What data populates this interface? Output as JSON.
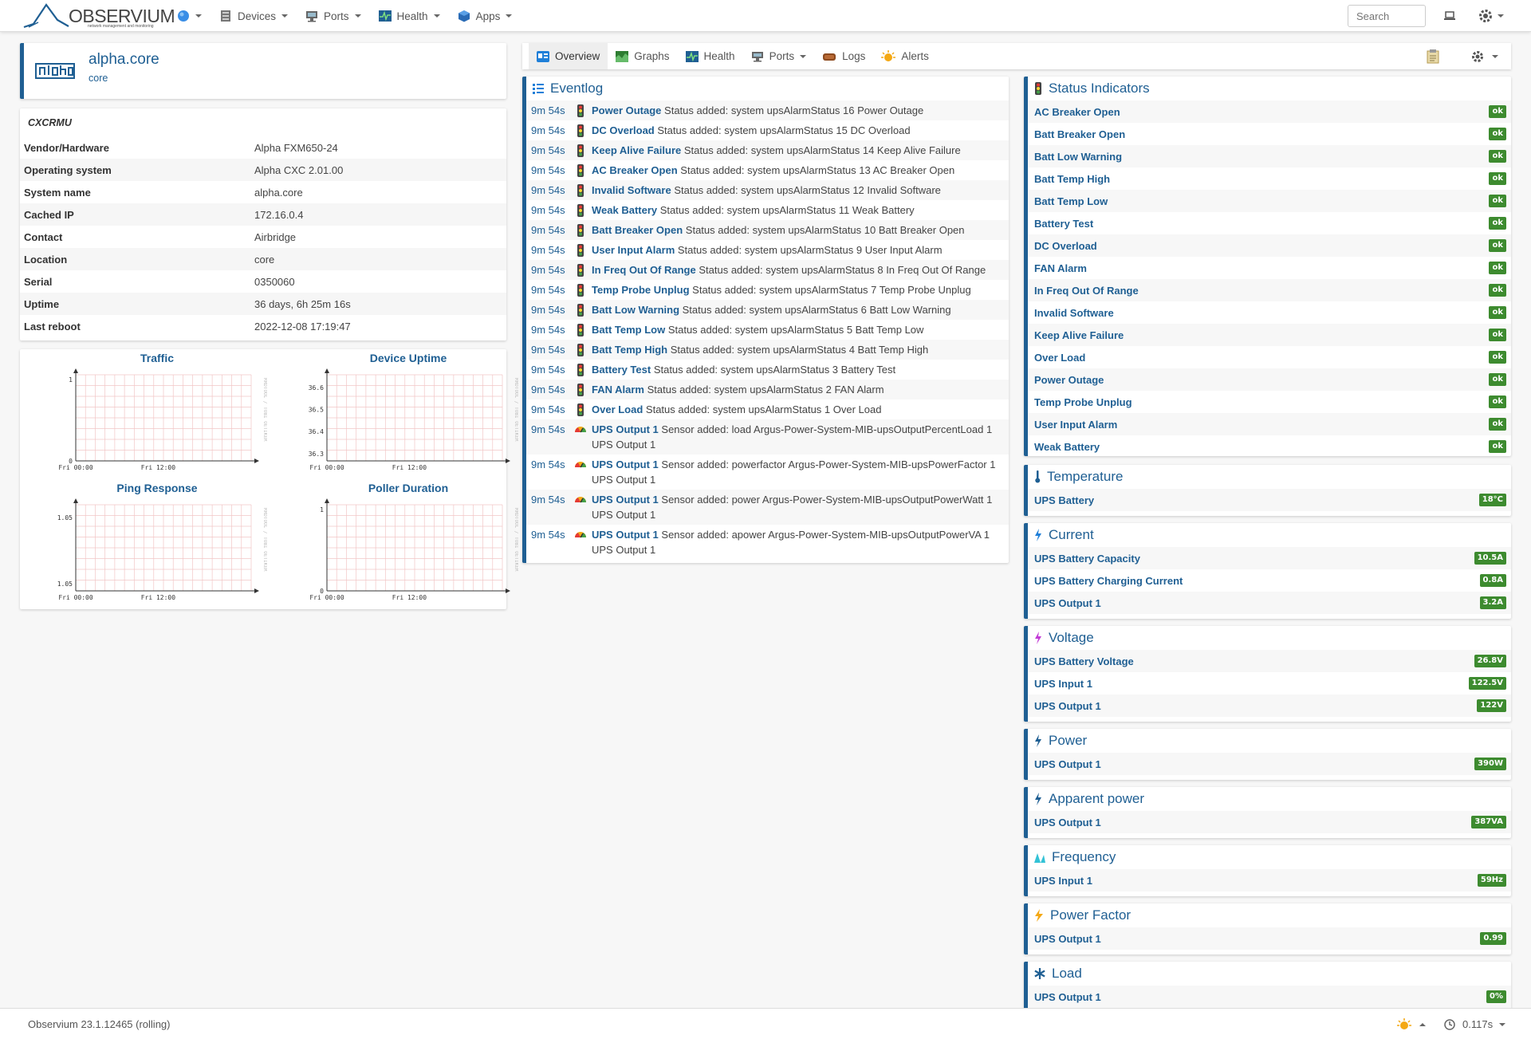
{
  "brand": {
    "name": "OBSERVIUM",
    "tagline": "network management and monitoring"
  },
  "nav": {
    "items": [
      {
        "label": "Devices"
      },
      {
        "label": "Ports"
      },
      {
        "label": "Health"
      },
      {
        "label": "Apps"
      }
    ],
    "search_placeholder": "Search"
  },
  "device": {
    "title": "alpha.core",
    "subtitle": "core",
    "logo_text": "alpha",
    "model_header": "CXCRMU",
    "info": [
      {
        "key": "Vendor/Hardware",
        "value": "Alpha FXM650-24"
      },
      {
        "key": "Operating system",
        "value": "Alpha CXC 2.01.00"
      },
      {
        "key": "System name",
        "value": "alpha.core"
      },
      {
        "key": "Cached IP",
        "value": "172.16.0.4"
      },
      {
        "key": "Contact",
        "value": "Airbridge"
      },
      {
        "key": "Location",
        "value": "core"
      },
      {
        "key": "Serial",
        "value": "0350060"
      },
      {
        "key": "Uptime",
        "value": "36 days, 6h 25m 16s"
      },
      {
        "key": "Last reboot",
        "value": "2022-12-08 17:19:47"
      }
    ]
  },
  "graphs": [
    {
      "title": "Traffic",
      "y_ticks": [
        "1",
        "0"
      ],
      "x_ticks": [
        "Fri 00:00",
        "Fri 12:00"
      ],
      "watermark": "RRDTOOL / TOBI OETIKER"
    },
    {
      "title": "Device Uptime",
      "y_ticks": [
        "36.6",
        "36.5",
        "36.4",
        "36.3"
      ],
      "x_ticks": [
        "Fri 00:00",
        "Fri 12:00"
      ],
      "watermark": "RRDTOOL / TOBI OETIKER"
    },
    {
      "title": "Ping Response",
      "y_ticks": [
        "1.05",
        "1.05"
      ],
      "x_ticks": [
        "Fri 00:00",
        "Fri 12:00"
      ],
      "watermark": "RRDTOOL / TOBI OETIKER"
    },
    {
      "title": "Poller Duration",
      "y_ticks": [
        "1",
        "0"
      ],
      "x_ticks": [
        "Fri 00:00",
        "Fri 12:00"
      ],
      "watermark": "RRDTOOL / TOBI OETIKER"
    }
  ],
  "tabs": [
    {
      "label": "Overview"
    },
    {
      "label": "Graphs"
    },
    {
      "label": "Health"
    },
    {
      "label": "Ports"
    },
    {
      "label": "Logs"
    },
    {
      "label": "Alerts"
    }
  ],
  "eventlog": {
    "title": "Eventlog",
    "rows": [
      {
        "time": "9m 54s",
        "type": "status",
        "entity": "Power Outage",
        "msg": "Status added: system upsAlarmStatus 16 Power Outage"
      },
      {
        "time": "9m 54s",
        "type": "status",
        "entity": "DC Overload",
        "msg": "Status added: system upsAlarmStatus 15 DC Overload"
      },
      {
        "time": "9m 54s",
        "type": "status",
        "entity": "Keep Alive Failure",
        "msg": "Status added: system upsAlarmStatus 14 Keep Alive Failure"
      },
      {
        "time": "9m 54s",
        "type": "status",
        "entity": "AC Breaker Open",
        "msg": "Status added: system upsAlarmStatus 13 AC Breaker Open"
      },
      {
        "time": "9m 54s",
        "type": "status",
        "entity": "Invalid Software",
        "msg": "Status added: system upsAlarmStatus 12 Invalid Software"
      },
      {
        "time": "9m 54s",
        "type": "status",
        "entity": "Weak Battery",
        "msg": "Status added: system upsAlarmStatus 11 Weak Battery"
      },
      {
        "time": "9m 54s",
        "type": "status",
        "entity": "Batt Breaker Open",
        "msg": "Status added: system upsAlarmStatus 10 Batt Breaker Open"
      },
      {
        "time": "9m 54s",
        "type": "status",
        "entity": "User Input Alarm",
        "msg": "Status added: system upsAlarmStatus 9 User Input Alarm"
      },
      {
        "time": "9m 54s",
        "type": "status",
        "entity": "In Freq Out Of Range",
        "msg": "Status added: system upsAlarmStatus 8 In Freq Out Of Range"
      },
      {
        "time": "9m 54s",
        "type": "status",
        "entity": "Temp Probe Unplug",
        "msg": "Status added: system upsAlarmStatus 7 Temp Probe Unplug"
      },
      {
        "time": "9m 54s",
        "type": "status",
        "entity": "Batt Low Warning",
        "msg": "Status added: system upsAlarmStatus 6 Batt Low Warning"
      },
      {
        "time": "9m 54s",
        "type": "status",
        "entity": "Batt Temp Low",
        "msg": "Status added: system upsAlarmStatus 5 Batt Temp Low"
      },
      {
        "time": "9m 54s",
        "type": "status",
        "entity": "Batt Temp High",
        "msg": "Status added: system upsAlarmStatus 4 Batt Temp High"
      },
      {
        "time": "9m 54s",
        "type": "status",
        "entity": "Battery Test",
        "msg": "Status added: system upsAlarmStatus 3 Battery Test"
      },
      {
        "time": "9m 54s",
        "type": "status",
        "entity": "FAN Alarm",
        "msg": "Status added: system upsAlarmStatus 2 FAN Alarm"
      },
      {
        "time": "9m 54s",
        "type": "status",
        "entity": "Over Load",
        "msg": "Status added: system upsAlarmStatus 1 Over Load"
      },
      {
        "time": "9m 54s",
        "type": "sensor",
        "entity": "UPS Output 1",
        "msg": "Sensor added: load Argus-Power-System-MIB-upsOutputPercentLoad 1 UPS Output 1"
      },
      {
        "time": "9m 54s",
        "type": "sensor",
        "entity": "UPS Output 1",
        "msg": "Sensor added: powerfactor Argus-Power-System-MIB-upsPowerFactor 1 UPS Output 1"
      },
      {
        "time": "9m 54s",
        "type": "sensor",
        "entity": "UPS Output 1",
        "msg": "Sensor added: power Argus-Power-System-MIB-upsOutputPowerWatt 1 UPS Output 1"
      },
      {
        "time": "9m 54s",
        "type": "sensor",
        "entity": "UPS Output 1",
        "msg": "Sensor added: apower Argus-Power-System-MIB-upsOutputPowerVA 1 UPS Output 1"
      }
    ]
  },
  "health": {
    "status_title": "Status Indicators",
    "status": [
      {
        "name": "AC Breaker Open",
        "value": "ok"
      },
      {
        "name": "Batt Breaker Open",
        "value": "ok"
      },
      {
        "name": "Batt Low Warning",
        "value": "ok"
      },
      {
        "name": "Batt Temp High",
        "value": "ok"
      },
      {
        "name": "Batt Temp Low",
        "value": "ok"
      },
      {
        "name": "Battery Test",
        "value": "ok"
      },
      {
        "name": "DC Overload",
        "value": "ok"
      },
      {
        "name": "FAN Alarm",
        "value": "ok"
      },
      {
        "name": "In Freq Out Of Range",
        "value": "ok"
      },
      {
        "name": "Invalid Software",
        "value": "ok"
      },
      {
        "name": "Keep Alive Failure",
        "value": "ok"
      },
      {
        "name": "Over Load",
        "value": "ok"
      },
      {
        "name": "Power Outage",
        "value": "ok"
      },
      {
        "name": "Temp Probe Unplug",
        "value": "ok"
      },
      {
        "name": "User Input Alarm",
        "value": "ok"
      },
      {
        "name": "Weak Battery",
        "value": "ok"
      }
    ],
    "sensors": [
      {
        "title": "Temperature",
        "icon": "thermometer-icon",
        "rows": [
          {
            "name": "UPS Battery",
            "value": "18°C"
          }
        ]
      },
      {
        "title": "Current",
        "icon": "current-bolt-icon",
        "rows": [
          {
            "name": "UPS Battery Capacity",
            "value": "10.5A"
          },
          {
            "name": "UPS Battery Charging Current",
            "value": "0.8A"
          },
          {
            "name": "UPS Output 1",
            "value": "3.2A"
          }
        ]
      },
      {
        "title": "Voltage",
        "icon": "voltage-bolt-icon",
        "rows": [
          {
            "name": "UPS Battery Voltage",
            "value": "26.8V"
          },
          {
            "name": "UPS Input 1",
            "value": "122.5V"
          },
          {
            "name": "UPS Output 1",
            "value": "122V"
          }
        ]
      },
      {
        "title": "Power",
        "icon": "power-bolt-icon",
        "rows": [
          {
            "name": "UPS Output 1",
            "value": "390W"
          }
        ]
      },
      {
        "title": "Apparent power",
        "icon": "apparent-power-bolt-icon",
        "rows": [
          {
            "name": "UPS Output 1",
            "value": "387VA"
          }
        ]
      },
      {
        "title": "Frequency",
        "icon": "frequency-icon",
        "rows": [
          {
            "name": "UPS Input 1",
            "value": "59Hz"
          }
        ]
      },
      {
        "title": "Power Factor",
        "icon": "power-factor-bolt-icon",
        "rows": [
          {
            "name": "UPS Output 1",
            "value": "0.99"
          }
        ]
      },
      {
        "title": "Load",
        "icon": "load-asterisk-icon",
        "rows": [
          {
            "name": "UPS Output 1",
            "value": "0%"
          }
        ]
      }
    ]
  },
  "footer": {
    "version": "Observium 23.1.12465 (rolling)",
    "timing": "0.117s"
  },
  "colors": {
    "accent": "#1f5f93",
    "ok_badge": "#3d8b2f",
    "graph_grid": "#f2c6c6"
  }
}
